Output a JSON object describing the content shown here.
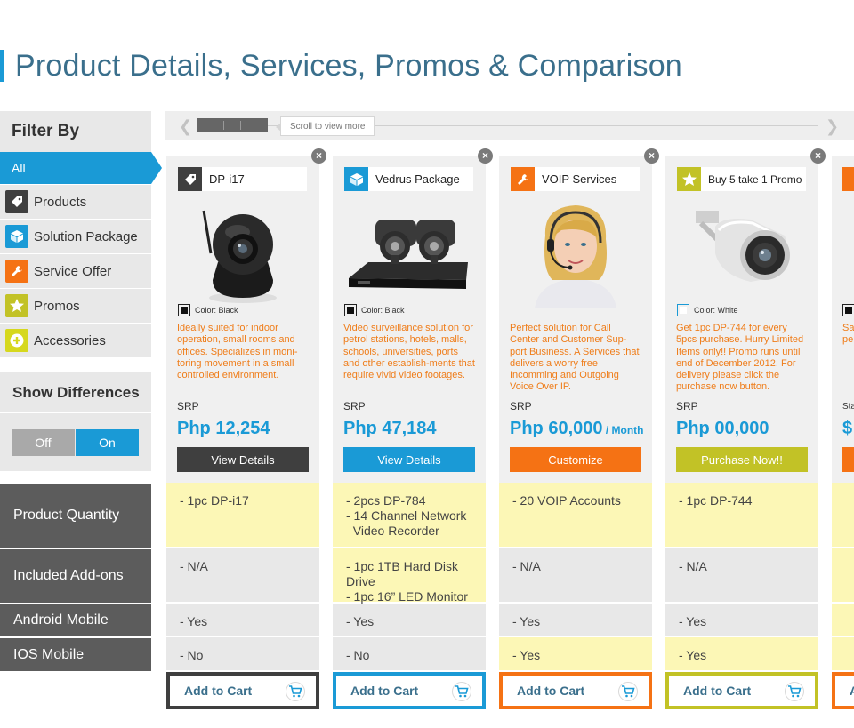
{
  "page": {
    "title": "Product Details, Services, Promos & Comparison"
  },
  "sidebar": {
    "filter_title": "Filter By",
    "items": [
      {
        "label": "All",
        "icon": "none",
        "active": true
      },
      {
        "label": "Products",
        "icon": "tag-icon"
      },
      {
        "label": "Solution Package",
        "icon": "box-icon"
      },
      {
        "label": "Service Offer",
        "icon": "wrench-icon"
      },
      {
        "label": "Promos",
        "icon": "star-icon"
      },
      {
        "label": "Accessories",
        "icon": "plus-icon"
      }
    ],
    "show_differences": "Show Differences",
    "toggle_off": "Off",
    "toggle_on": "On"
  },
  "row_labels": [
    "Product Quantity",
    "Included Add-ons",
    "Android Mobile",
    "IOS Mobile"
  ],
  "scroller": {
    "tip": "Scroll to view more"
  },
  "products": [
    {
      "name": "DP-i17",
      "icon": "tag-icon",
      "color_label": "Color: Black",
      "desc": "Ideally suited for indoor operation, small rooms and offices. Specializes in moni-toring movement in a small controlled environment.",
      "srp": "SRP",
      "price": "Php 12,254",
      "price_suffix": "",
      "cta": "View Details",
      "quantity": [
        "- 1pc DP-i17"
      ],
      "addons": [
        "- N/A"
      ],
      "android": "- Yes",
      "ios": "- No",
      "cart": "Add to Cart"
    },
    {
      "name": "Vedrus Package",
      "icon": "box-icon",
      "color_label": "Color: Black",
      "desc": "Video surveillance solution for petrol stations, hotels, malls, schools, universities, ports and other establish-ments that require vivid video footages.",
      "srp": "SRP",
      "price": "Php 47,184",
      "price_suffix": "",
      "cta": "View Details",
      "quantity": [
        "- 2pcs DP-784",
        "- 14 Channel Network",
        "  Video Recorder"
      ],
      "addons": [
        "- 1pc 1TB Hard Disk Drive",
        "- 1pc 16” LED Monitor"
      ],
      "android": "- Yes",
      "ios": "- No",
      "cart": "Add to Cart"
    },
    {
      "name": "VOIP Services",
      "icon": "wrench-icon",
      "color_label": "",
      "desc": "Perfect solution for Call Center and Customer Sup-port Business. A Services that delivers a worry free Incomming and Outgoing Voice Over IP.",
      "srp": "SRP",
      "price": "Php 60,000",
      "price_suffix": " / Month",
      "cta": "Customize",
      "quantity": [
        "- 20 VOIP Accounts"
      ],
      "addons": [
        "- N/A"
      ],
      "android": "- Yes",
      "ios": "- Yes",
      "cart": "Add to Cart"
    },
    {
      "name": "Buy 5 take 1 Promo",
      "icon": "star-icon",
      "color_label": "Color: White",
      "desc": "Get 1pc DP-744 for every 5pcs purchase. Hurry Limited Items only!! Promo runs until end of December 2012. For delivery please click the purchase now button.",
      "srp": "SRP",
      "price": "Php 00,000",
      "price_suffix": "",
      "cta": "Purchase Now!!",
      "quantity": [
        "- 1pc DP-744"
      ],
      "addons": [
        "- N/A"
      ],
      "android": "- Yes",
      "ios": "- Yes",
      "cart": "Add to Cart"
    }
  ],
  "partial_column": {
    "desc_fragment": "Sa pe",
    "srp_fragment": "Sta",
    "price_fragment": "$",
    "cart_fragment": "A"
  },
  "colors": {
    "accent_blue": "#1a9ad6",
    "orange": "#f57214",
    "olive": "#c2c226",
    "dark": "#3f3f3f",
    "yellow_cell": "#fcf7b6"
  }
}
